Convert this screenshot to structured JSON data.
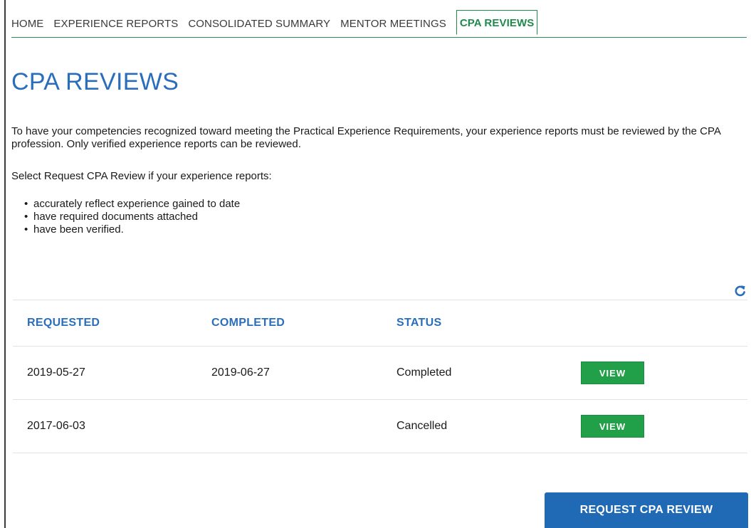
{
  "nav": {
    "tabs": [
      {
        "label": "HOME"
      },
      {
        "label": "EXPERIENCE REPORTS"
      },
      {
        "label": "CONSOLIDATED SUMMARY"
      },
      {
        "label": "MENTOR MEETINGS"
      },
      {
        "label": "CPA REVIEWS",
        "active": true
      }
    ]
  },
  "page": {
    "title": "CPA REVIEWS",
    "intro": "To have your competencies recognized toward meeting the Practical Experience Requirements, your experience reports must be reviewed by the CPA profession. Only verified experience reports can be reviewed.",
    "select_text": "Select Request CPA Review if your experience reports:",
    "bullets": [
      "accurately reflect experience gained to date",
      "have required documents attached",
      "have been verified."
    ],
    "refresh_icon": "refresh-icon"
  },
  "table": {
    "headers": [
      "REQUESTED",
      "COMPLETED",
      "STATUS"
    ],
    "rows": [
      {
        "requested": "2019-05-27",
        "completed": "2019-06-27",
        "status": "Completed",
        "action": "VIEW"
      },
      {
        "requested": "2017-06-03",
        "completed": "",
        "status": "Cancelled",
        "action": "VIEW"
      }
    ]
  },
  "actions": {
    "request_label": "REQUEST CPA REVIEW"
  },
  "colors": {
    "accent_blue": "#2a6ebb",
    "accent_green": "#1f8a4c",
    "button_green": "#22a049",
    "button_blue": "#1f69b5"
  }
}
